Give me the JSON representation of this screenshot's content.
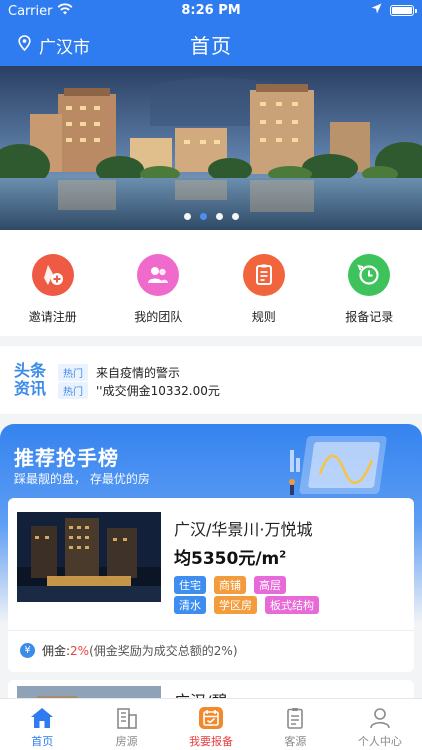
{
  "status_bar": {
    "carrier": "Carrier",
    "time": "8:26 PM"
  },
  "header": {
    "city": "广汉市",
    "title": "首页"
  },
  "banner": {
    "slide_count": 4,
    "active_index": 1
  },
  "quick_menu": [
    {
      "label": "邀请注册",
      "icon": "invite-icon",
      "color": "#ef5a45"
    },
    {
      "label": "我的团队",
      "icon": "team-icon",
      "color": "#f06acb"
    },
    {
      "label": "规则",
      "icon": "rules-icon",
      "color": "#f2653c"
    },
    {
      "label": "报备记录",
      "icon": "record-icon",
      "color": "#3ec35c"
    }
  ],
  "news": {
    "logo_line1": "头条",
    "logo_line2": "资讯",
    "items": [
      {
        "tag": "热门",
        "text": "来自疫情的警示"
      },
      {
        "tag": "热门",
        "text": "''成交佣金10332.00元"
      }
    ]
  },
  "recommend": {
    "title": "推荐抢手榜",
    "subtitle": "踩最靓的盘，  存最优的房",
    "cards": [
      {
        "name": "广汉/华景川·万悦城",
        "price": "均5350元/m",
        "price_sup": "2",
        "tags_row1": [
          "住宅",
          "商铺",
          "高层"
        ],
        "tags_row2": [
          "清水",
          "学区房",
          "板式结构"
        ],
        "commission_label": "佣金:",
        "commission_pct": "2%",
        "commission_note": "(佣金奖励为成交总额的2%)"
      },
      {
        "name": "广汉/碧"
      }
    ]
  },
  "tabbar": [
    {
      "label": "首页",
      "icon": "home-icon",
      "state": "active"
    },
    {
      "label": "房源",
      "icon": "building-icon",
      "state": "normal"
    },
    {
      "label": "我要报备",
      "icon": "report-icon",
      "state": "report"
    },
    {
      "label": "客源",
      "icon": "clipboard-icon",
      "state": "normal"
    },
    {
      "label": "个人中心",
      "icon": "person-icon",
      "state": "normal"
    }
  ],
  "colors": {
    "primary": "#2f7cf0",
    "accent_red": "#e94242"
  }
}
